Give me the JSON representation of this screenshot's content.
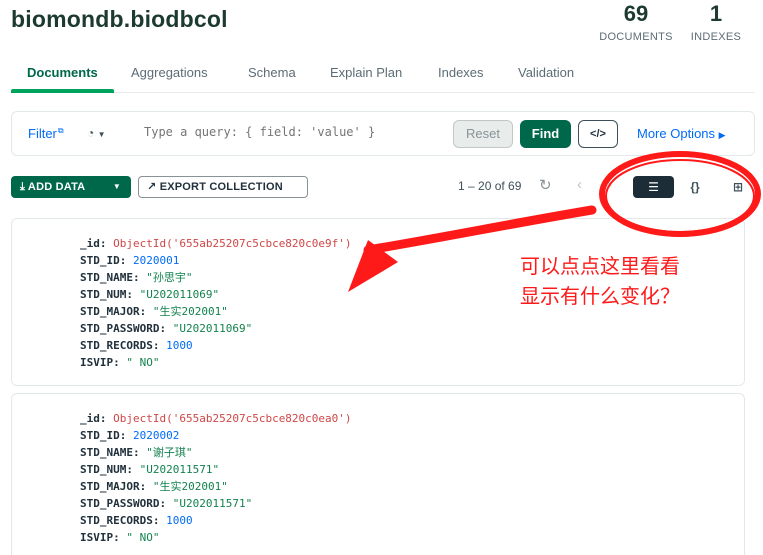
{
  "header": {
    "namespace": "biomondb.biodbcol",
    "stats": [
      {
        "value": "69",
        "label": "DOCUMENTS"
      },
      {
        "value": "1",
        "label": "INDEXES"
      }
    ]
  },
  "tabs": [
    "Documents",
    "Aggregations",
    "Schema",
    "Explain Plan",
    "Indexes",
    "Validation"
  ],
  "querybar": {
    "filter_label": "Filter",
    "placeholder": "Type a query: { field: 'value' }",
    "reset_label": "Reset",
    "find_label": "Find",
    "more_options_label": "More Options"
  },
  "toolbar": {
    "add_data_label": "ADD DATA",
    "export_label": "EXPORT COLLECTION",
    "pagination_text": "1 – 20 of 69"
  },
  "documents": [
    {
      "fields": [
        {
          "key": "_id",
          "value": "ObjectId('655ab25207c5cbce820c0e9f')"
        },
        {
          "key": "STD_ID",
          "value": "2020001"
        },
        {
          "key": "STD_NAME",
          "value": "\"孙思宇\""
        },
        {
          "key": "STD_NUM",
          "value": "\"U202011069\""
        },
        {
          "key": "STD_MAJOR",
          "value": "\"生实202001\""
        },
        {
          "key": "STD_PASSWORD",
          "value": "\"U202011069\""
        },
        {
          "key": "STD_RECORDS",
          "value": "1000"
        },
        {
          "key": "ISVIP",
          "value": "\" NO\""
        }
      ]
    },
    {
      "fields": [
        {
          "key": "_id",
          "value": "ObjectId('655ab25207c5cbce820c0ea0')"
        },
        {
          "key": "STD_ID",
          "value": "2020002"
        },
        {
          "key": "STD_NAME",
          "value": "\"谢子琪\""
        },
        {
          "key": "STD_NUM",
          "value": "\"U202011571\""
        },
        {
          "key": "STD_MAJOR",
          "value": "\"生实202001\""
        },
        {
          "key": "STD_PASSWORD",
          "value": "\"U202011571\""
        },
        {
          "key": "STD_RECORDS",
          "value": "1000"
        },
        {
          "key": "ISVIP",
          "value": "\" NO\""
        }
      ]
    }
  ],
  "annotation": {
    "line1": "可以点点这里看看",
    "line2": "显示有什么变化？",
    "color": "#ff1a1a"
  },
  "colors": {
    "brand_green": "#00684a",
    "accent_green": "#00a35c",
    "link_blue": "#016bf8",
    "string_green": "#12824d",
    "objectid_red": "#cf4747"
  }
}
